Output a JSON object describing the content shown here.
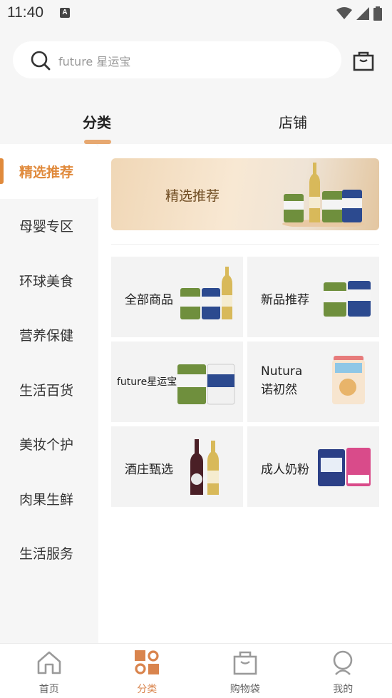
{
  "status_bar": {
    "time": "11:40",
    "notification_icon": "A"
  },
  "search": {
    "placeholder": "future 星运宝"
  },
  "tabs": [
    {
      "label": "分类",
      "active": true
    },
    {
      "label": "店铺",
      "active": false
    }
  ],
  "sidebar": {
    "items": [
      {
        "label": "精选推荐",
        "active": true
      },
      {
        "label": "母婴专区"
      },
      {
        "label": "环球美食"
      },
      {
        "label": "营养保健"
      },
      {
        "label": "生活百货"
      },
      {
        "label": "美妆个护"
      },
      {
        "label": "肉果生鲜"
      },
      {
        "label": "生活服务"
      }
    ]
  },
  "banner": {
    "title": "精选推荐"
  },
  "categories": [
    {
      "label": "全部商品",
      "icon": "milk-cans-and-wine-image"
    },
    {
      "label": "新品推荐",
      "icon": "milk-cans-image"
    },
    {
      "label": "future星运宝",
      "icon": "milk-cans-image"
    },
    {
      "label_line1": "Nutura",
      "label_line2": "诺初然",
      "icon": "formula-can-image"
    },
    {
      "label": "酒庄甄选",
      "icon": "wine-bottles-image"
    },
    {
      "label": "成人奶粉",
      "icon": "adult-milk-powder-image"
    }
  ],
  "bottom_nav": [
    {
      "label": "首页",
      "icon": "home-icon",
      "active": false
    },
    {
      "label": "分类",
      "icon": "category-icon",
      "active": true
    },
    {
      "label": "购物袋",
      "icon": "shopping-bag-icon",
      "active": false
    },
    {
      "label": "我的",
      "icon": "profile-icon",
      "active": false
    }
  ],
  "colors": {
    "accent": "#e08a3c",
    "nav_active": "#d9844d",
    "underline": "#e7a870",
    "background": "#f6f6f6"
  }
}
